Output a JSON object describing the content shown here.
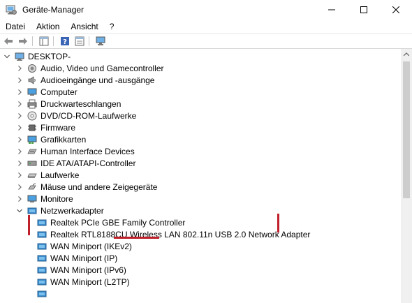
{
  "window": {
    "title": "Geräte-Manager"
  },
  "menu": [
    "Datei",
    "Aktion",
    "Ansicht",
    "?"
  ],
  "tree": {
    "root": "DESKTOP-",
    "categories": [
      "Audio, Video und Gamecontroller",
      "Audioeingänge und -ausgänge",
      "Computer",
      "Druckwarteschlangen",
      "DVD/CD-ROM-Laufwerke",
      "Firmware",
      "Grafikkarten",
      "Human Interface Devices",
      "IDE ATA/ATAPI-Controller",
      "Laufwerke",
      "Mäuse und andere Zeigegeräte",
      "Monitore",
      "Netzwerkadapter"
    ],
    "network_adapters": [
      "Realtek PCIe GBE Family Controller",
      "Realtek RTL8188CU Wireless LAN 802.11n USB 2.0 Network Adapter",
      "WAN Miniport (IKEv2)",
      "WAN Miniport (IP)",
      "WAN Miniport (IPv6)",
      "WAN Miniport (L2TP)"
    ]
  },
  "colors": {
    "highlight_marker": "#c0202a",
    "adapter_icon": "#3b8ed0"
  }
}
